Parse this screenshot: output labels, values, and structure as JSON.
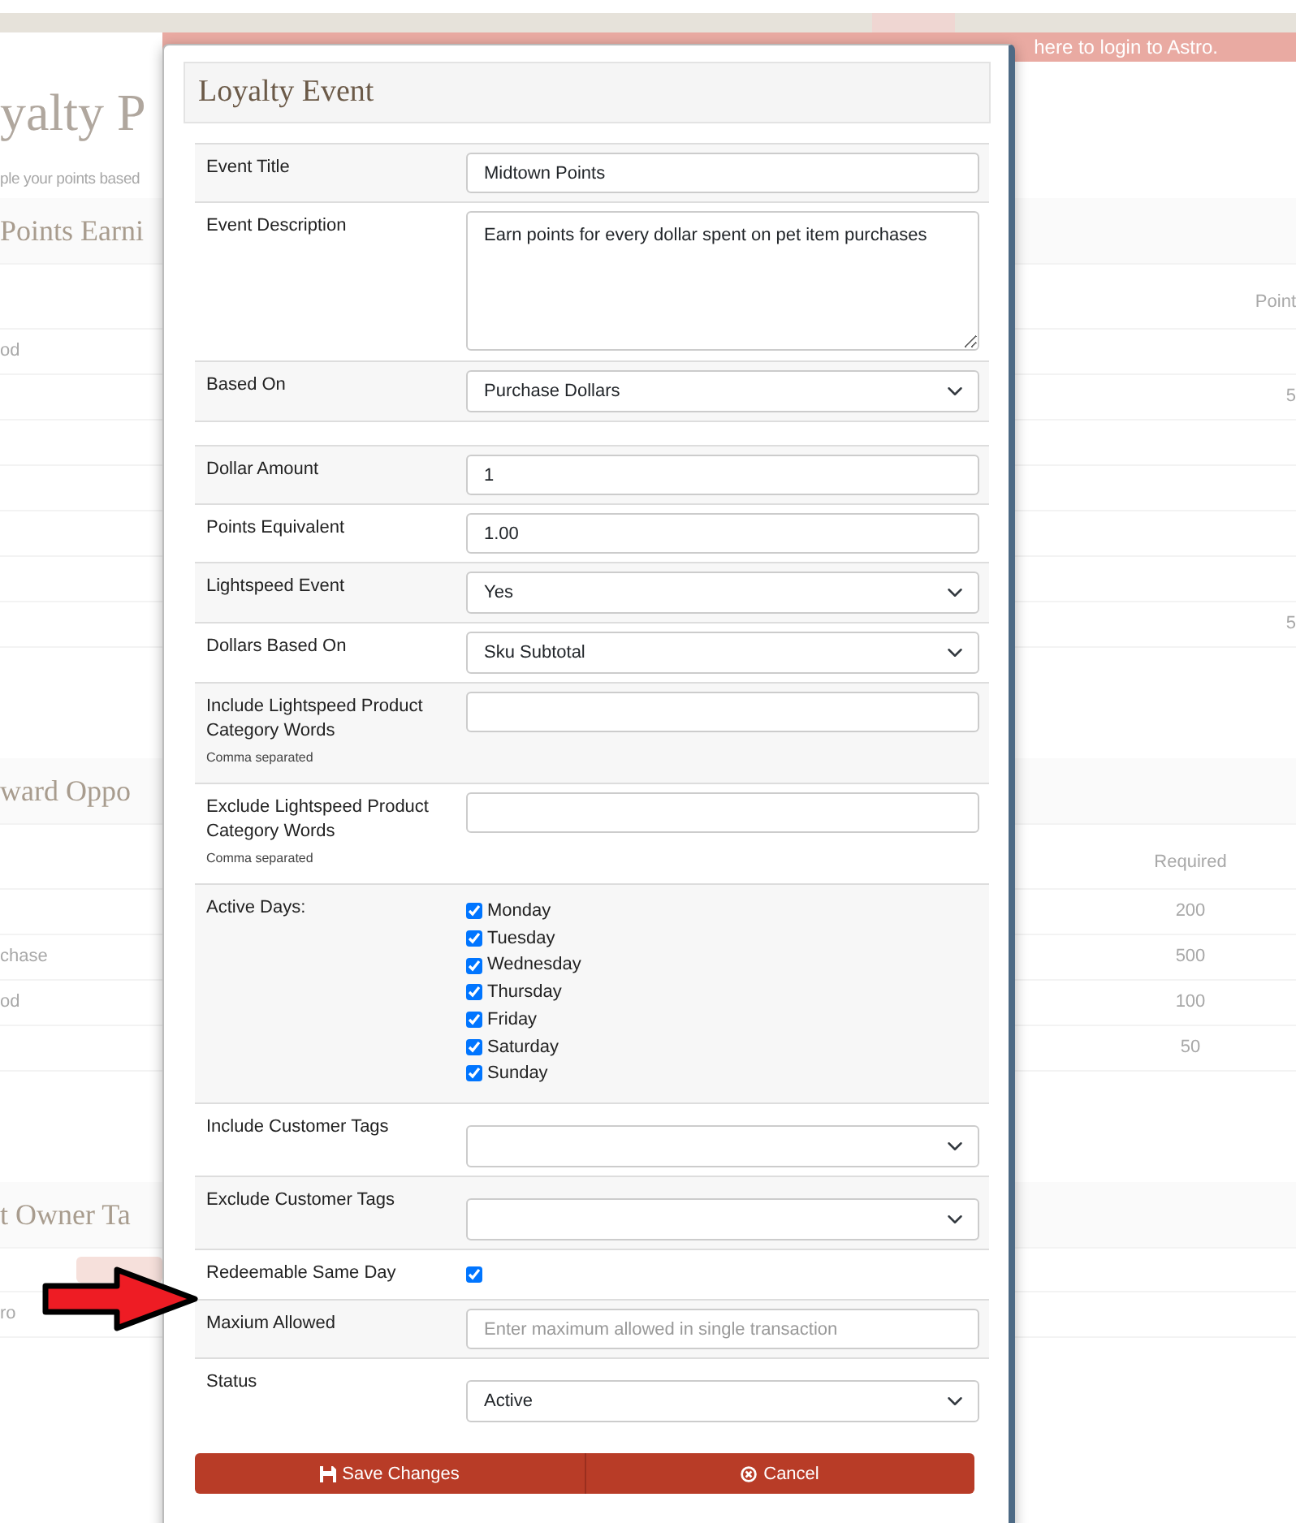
{
  "background": {
    "banner_text": "here to login to Astro.",
    "rows": [
      {
        "kind": "title",
        "left": "yalty P"
      },
      {
        "kind": "subtitle",
        "left": "ple your points based"
      },
      {
        "kind": "section",
        "left": "Points Earni"
      },
      {
        "kind": "header",
        "edge": "Point"
      },
      {
        "kind": "row",
        "left": "od"
      },
      {
        "kind": "row",
        "edge": "5"
      },
      {
        "kind": "row"
      },
      {
        "kind": "row"
      },
      {
        "kind": "row"
      },
      {
        "kind": "row"
      },
      {
        "kind": "row",
        "edge": "5"
      },
      {
        "kind": "gap"
      },
      {
        "kind": "section",
        "left": "ward Oppo"
      },
      {
        "kind": "header",
        "mid": "Required"
      },
      {
        "kind": "row",
        "mid": "200"
      },
      {
        "kind": "row",
        "left": "chase",
        "mid": "500"
      },
      {
        "kind": "row",
        "left": "od",
        "mid": "100"
      },
      {
        "kind": "row",
        "mid": "50"
      },
      {
        "kind": "gap"
      },
      {
        "kind": "section",
        "left": "t Owner Ta"
      },
      {
        "kind": "buttonrow"
      },
      {
        "kind": "row",
        "left": "ro"
      }
    ]
  },
  "modal": {
    "title": "Loyalty Event",
    "fields": [
      {
        "kind": "text",
        "label": "Event Title",
        "value": "Midtown Points"
      },
      {
        "kind": "textarea",
        "label": "Event Description",
        "value": "Earn points for every dollar spent on pet item purchases"
      },
      {
        "kind": "select",
        "label": "Based On",
        "value": "Purchase Dollars"
      },
      {
        "kind": "spacer"
      },
      {
        "kind": "text",
        "label": "Dollar Amount",
        "value": "1"
      },
      {
        "kind": "text",
        "label": "Points Equivalent",
        "value": "1.00"
      },
      {
        "kind": "select",
        "label": "Lightspeed Event",
        "value": "Yes"
      },
      {
        "kind": "select",
        "label": "Dollars Based On",
        "value": "Sku Subtotal"
      },
      {
        "kind": "text",
        "label": "Include Lightspeed Product Category Words",
        "note": "Comma separated"
      },
      {
        "kind": "text",
        "label": "Exclude Lightspeed Product Category Words",
        "note": "Comma separated"
      },
      {
        "kind": "checkboxes",
        "label": "Active Days:",
        "options": [
          {
            "label": "Monday",
            "checked": true
          },
          {
            "label": "Tuesday",
            "checked": true
          },
          {
            "label": "Wednesday",
            "checked": true
          },
          {
            "label": "Thursday",
            "checked": true
          },
          {
            "label": "Friday",
            "checked": true
          },
          {
            "label": "Saturday",
            "checked": true
          },
          {
            "label": "Sunday",
            "checked": true
          }
        ]
      },
      {
        "kind": "select",
        "label": "Include Customer Tags"
      },
      {
        "kind": "select",
        "label": "Exclude Customer Tags"
      },
      {
        "kind": "checkbox",
        "label": "Redeemable Same Day",
        "checked": true
      },
      {
        "kind": "text",
        "label": "Maxium Allowed",
        "placeholder": "Enter maximum allowed in single transaction"
      },
      {
        "kind": "select",
        "label": "Status",
        "value": "Active"
      }
    ],
    "buttons": [
      {
        "kind": "save",
        "label": "Save Changes"
      },
      {
        "kind": "cancel",
        "label": "Cancel"
      }
    ]
  }
}
